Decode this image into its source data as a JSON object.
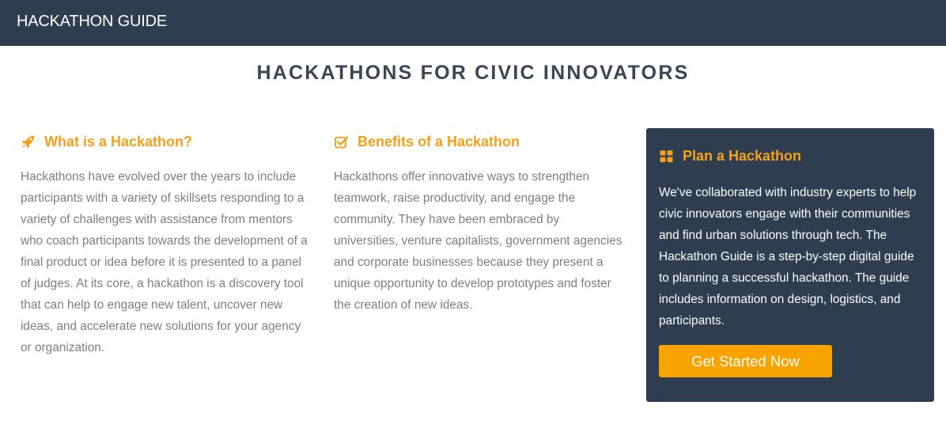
{
  "navbar": {
    "brand": "HACKATHON GUIDE"
  },
  "page": {
    "title": "HACKATHONS FOR CIVIC INNOVATORS"
  },
  "columns": [
    {
      "icon": "rocket-icon",
      "heading": "What is a Hackathon?",
      "body": "Hackathons have evolved over the years to include participants with a variety of skillsets responding to a variety of challenges with assistance from mentors who coach participants towards the development of a final product or idea before it is presented to a panel of judges. At its core, a hackathon is a discovery tool that can help to engage new talent, uncover new ideas, and accelerate new solutions for your agency or organization."
    },
    {
      "icon": "check-square-icon",
      "heading": "Benefits of a Hackathon",
      "body": "Hackathons offer innovative ways to strengthen teamwork, raise productivity, and engage the community. They have been embraced by universities, venture capitalists, government agencies and corporate businesses because they present a unique opportunity to develop prototypes and foster the creation of new ideas."
    }
  ],
  "plan_card": {
    "icon": "grid-icon",
    "heading": "Plan a Hackathon",
    "body": "We've collaborated with industry experts to help civic innovators engage with their communities and find urban solutions through tech. The Hackathon Guide is a step-by-step digital guide to planning a successful hackathon. The guide includes information on design, logistics, and participants.",
    "button_label": "Get Started Now"
  },
  "colors": {
    "navbar_bg": "#2e3d4f",
    "accent": "#f6a01a",
    "button_bg": "#f8a300",
    "body_text": "#7f7f7f"
  }
}
